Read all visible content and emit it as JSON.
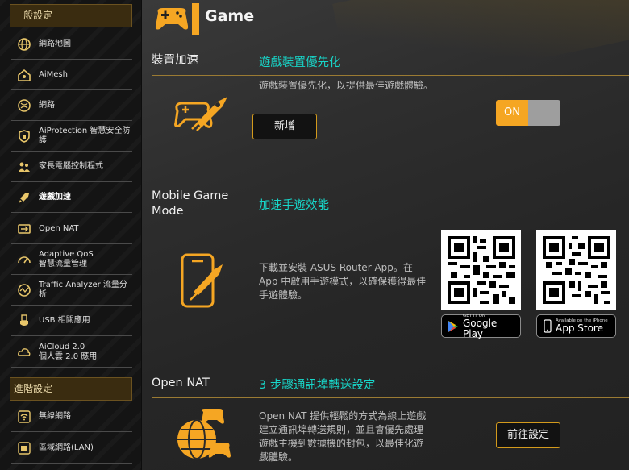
{
  "sidebar": {
    "general_header": "一般設定",
    "general_items": [
      {
        "label": "網路地圖",
        "icon": "globe-icon"
      },
      {
        "label": "AiMesh",
        "icon": "home-mesh-icon"
      },
      {
        "label": "網路",
        "icon": "network-globe-icon"
      },
      {
        "label": "AiProtection 智慧安全防護",
        "icon": "shield-icon"
      },
      {
        "label": "家長電腦控制程式",
        "icon": "family-icon"
      },
      {
        "label": "遊戲加速",
        "icon": "rocket-icon"
      },
      {
        "label": "Open NAT",
        "icon": "nat-icon"
      },
      {
        "label": "Adaptive QoS\n智慧流量管理",
        "icon": "speedometer-icon"
      },
      {
        "label": "Traffic Analyzer 流量分析",
        "icon": "analyzer-icon"
      },
      {
        "label": "USB 相關應用",
        "icon": "usb-icon"
      },
      {
        "label": "AiCloud 2.0\n個人雲 2.0 應用",
        "icon": "cloud-icon"
      }
    ],
    "advanced_header": "進階設定",
    "advanced_items": [
      {
        "label": "無線網路",
        "icon": "wifi-icon"
      },
      {
        "label": "區域網路(LAN)",
        "icon": "lan-icon"
      }
    ]
  },
  "page": {
    "title": "Game"
  },
  "device_boost": {
    "label": "裝置加速",
    "heading": "遊戲裝置優先化",
    "description": "遊戲裝置優先化，以提供最佳遊戲體驗。",
    "add_button": "新增",
    "toggle_state": "ON"
  },
  "mobile_game": {
    "label": "Mobile Game Mode",
    "heading": "加速手遊效能",
    "description": "下載並安裝 ASUS Router App。在 App 中啟用手遊模式，以確保獲得最佳手遊體驗。",
    "google_play": {
      "small": "GET IT ON",
      "big": "Google Play"
    },
    "app_store": {
      "small": "Available on the iPhone",
      "big": "App Store"
    }
  },
  "open_nat": {
    "label": "Open NAT",
    "heading": "3 步驟通訊埠轉送設定",
    "description": "Open NAT 提供輕鬆的方式為線上遊戲建立通訊埠轉送規則，並且會優先處理遊戲主機到數據機的封包，以最佳化遊戲體驗。",
    "go_button": "前往設定"
  },
  "colors": {
    "accent": "#f5a623",
    "heading": "#18d6c9",
    "divider": "#9b7b33"
  }
}
